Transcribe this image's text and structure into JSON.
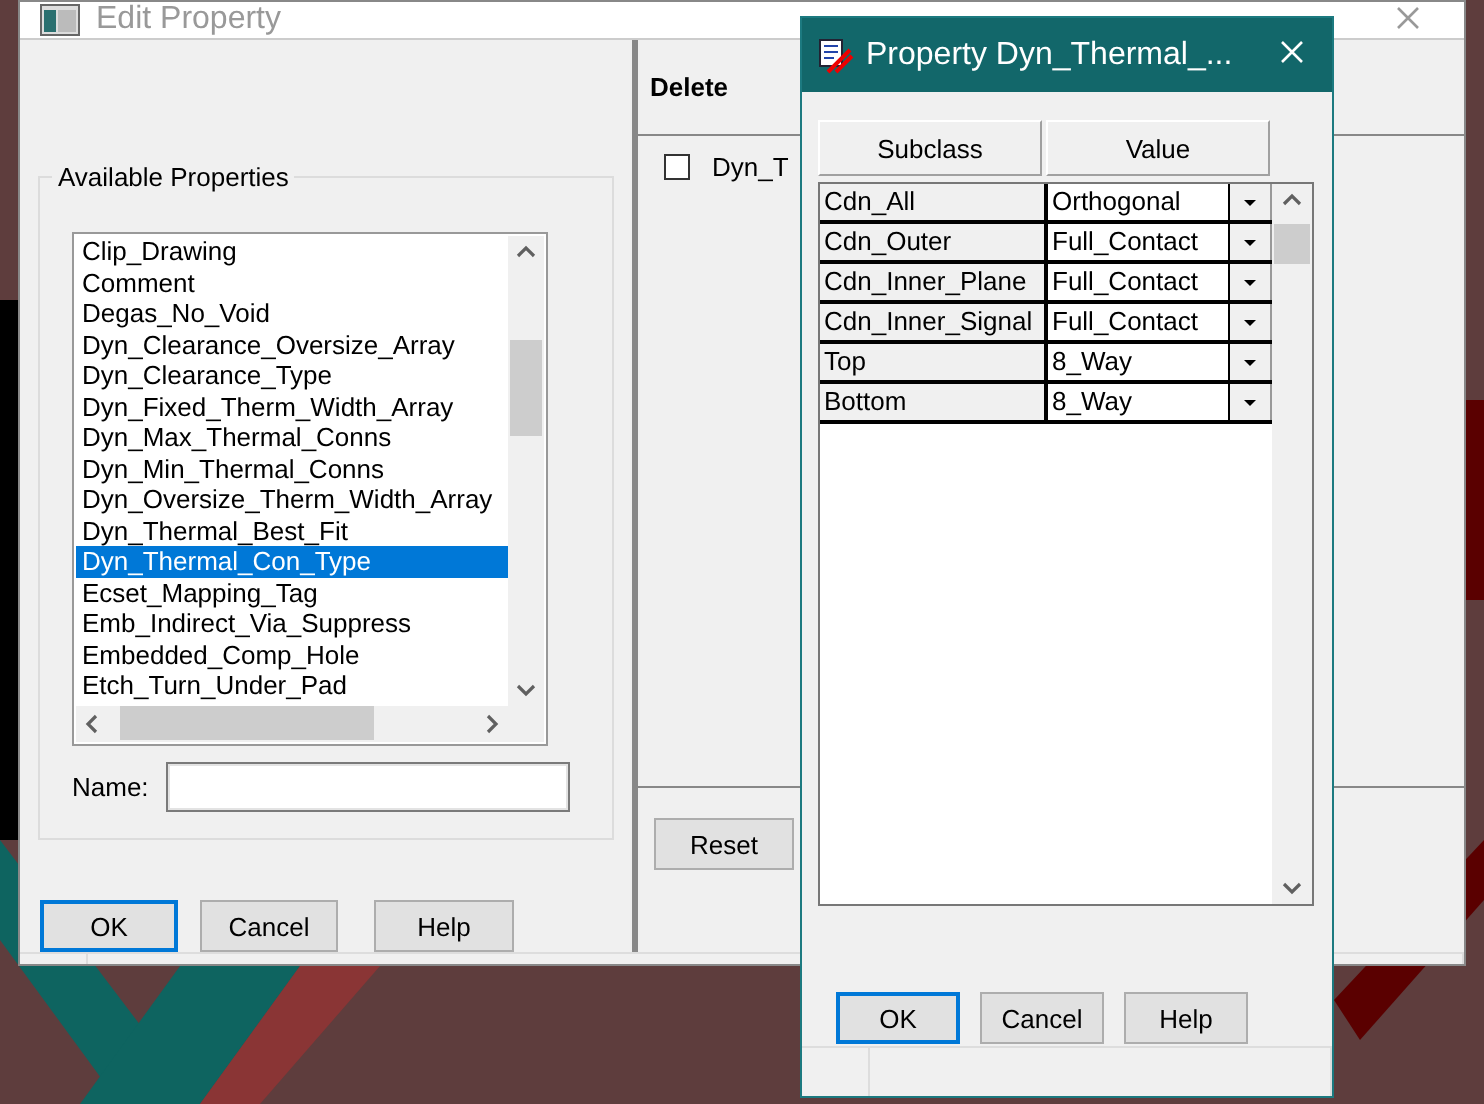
{
  "main_window": {
    "title": "Edit Property",
    "available_properties": {
      "label": "Available Properties",
      "items": [
        {
          "label": "Clip_Drawing",
          "selected": false
        },
        {
          "label": "Comment",
          "selected": false
        },
        {
          "label": "Degas_No_Void",
          "selected": false
        },
        {
          "label": "Dyn_Clearance_Oversize_Array",
          "selected": false
        },
        {
          "label": "Dyn_Clearance_Type",
          "selected": false
        },
        {
          "label": "Dyn_Fixed_Therm_Width_Array",
          "selected": false
        },
        {
          "label": "Dyn_Max_Thermal_Conns",
          "selected": false
        },
        {
          "label": "Dyn_Min_Thermal_Conns",
          "selected": false
        },
        {
          "label": "Dyn_Oversize_Therm_Width_Array",
          "selected": false
        },
        {
          "label": "Dyn_Thermal_Best_Fit",
          "selected": false
        },
        {
          "label": "Dyn_Thermal_Con_Type",
          "selected": true
        },
        {
          "label": "Ecset_Mapping_Tag",
          "selected": false
        },
        {
          "label": "Emb_Indirect_Via_Suppress",
          "selected": false
        },
        {
          "label": "Embedded_Comp_Hole",
          "selected": false
        },
        {
          "label": "Etch_Turn_Under_Pad",
          "selected": false
        }
      ],
      "name_label": "Name:"
    },
    "buttons": [
      {
        "label": "OK",
        "default": true
      },
      {
        "label": "Cancel",
        "default": false
      },
      {
        "label": "Help",
        "default": false
      }
    ],
    "delete_panel": {
      "header": "Delete",
      "rows": [
        {
          "label": "Dyn_T",
          "checked": false
        }
      ],
      "reset_button": "Reset"
    }
  },
  "property_dialog": {
    "title": "Property Dyn_Thermal_...",
    "columns": [
      "Subclass",
      "Value"
    ],
    "rows": [
      {
        "subclass": "Cdn_All",
        "value": "Orthogonal"
      },
      {
        "subclass": "Cdn_Outer",
        "value": "Full_Contact"
      },
      {
        "subclass": "Cdn_Inner_Plane",
        "value": "Full_Contact"
      },
      {
        "subclass": "Cdn_Inner_Signal",
        "value": "Full_Contact"
      },
      {
        "subclass": "Top",
        "value": "8_Way"
      },
      {
        "subclass": "Bottom",
        "value": "8_Way"
      }
    ],
    "buttons": [
      {
        "label": "OK",
        "default": true
      },
      {
        "label": "Cancel",
        "default": false
      },
      {
        "label": "Help",
        "default": false
      }
    ]
  }
}
